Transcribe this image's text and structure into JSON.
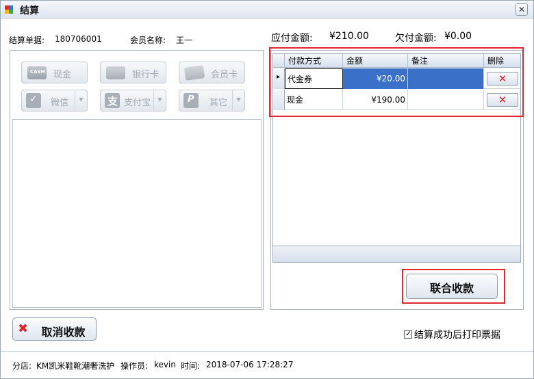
{
  "window": {
    "title": "结算",
    "close_glyph": "✕"
  },
  "order": {
    "number_label": "结算单据:",
    "number": "180706001",
    "member_label": "会员名称:",
    "member": "王一"
  },
  "amounts": {
    "due_label": "应付金额:",
    "due": "¥210.00",
    "owed_label": "欠付金额:",
    "owed": "¥0.00"
  },
  "payment_buttons": [
    {
      "label": "现金",
      "icon": "cash-icon",
      "icon_text": "CASH"
    },
    {
      "label": "银行卡",
      "icon": "bank-card-icon"
    },
    {
      "label": "会员卡",
      "icon": "member-card-icon"
    },
    {
      "label": "微信",
      "icon": "wechat-icon",
      "icon_text": "✓"
    },
    {
      "label": "支付宝",
      "icon": "alipay-icon",
      "icon_text": "支"
    },
    {
      "label": "其它",
      "icon": "other-pay-icon",
      "icon_text": "P"
    }
  ],
  "dropdown_glyph": "▼",
  "grid": {
    "columns": [
      "付款方式",
      "金额",
      "备注",
      "删除"
    ],
    "rows": [
      {
        "method": "代金券",
        "amount": "¥20.00",
        "note": "",
        "delete": "✕"
      },
      {
        "method": "现金",
        "amount": "¥190.00",
        "note": "",
        "delete": "✕"
      }
    ],
    "current_row_glyph": "▸"
  },
  "buttons": {
    "combined": "联合收款",
    "cancel": "取消收款",
    "cancel_glyph": "✖"
  },
  "print_option": {
    "label": "结算成功后打印票据",
    "checked_glyph": "✓"
  },
  "status": {
    "branch_label": "分店:",
    "branch": "KM凯米鞋靴潮奢洗护",
    "operator_label": "操作员:",
    "operator": "kevin",
    "time_label": "时间:",
    "time": "2018-07-06 17:28:27"
  },
  "colors": {
    "selected_row": "#3a70c8",
    "highlight": "#e2262b",
    "delete_icon": "#e0262b"
  }
}
